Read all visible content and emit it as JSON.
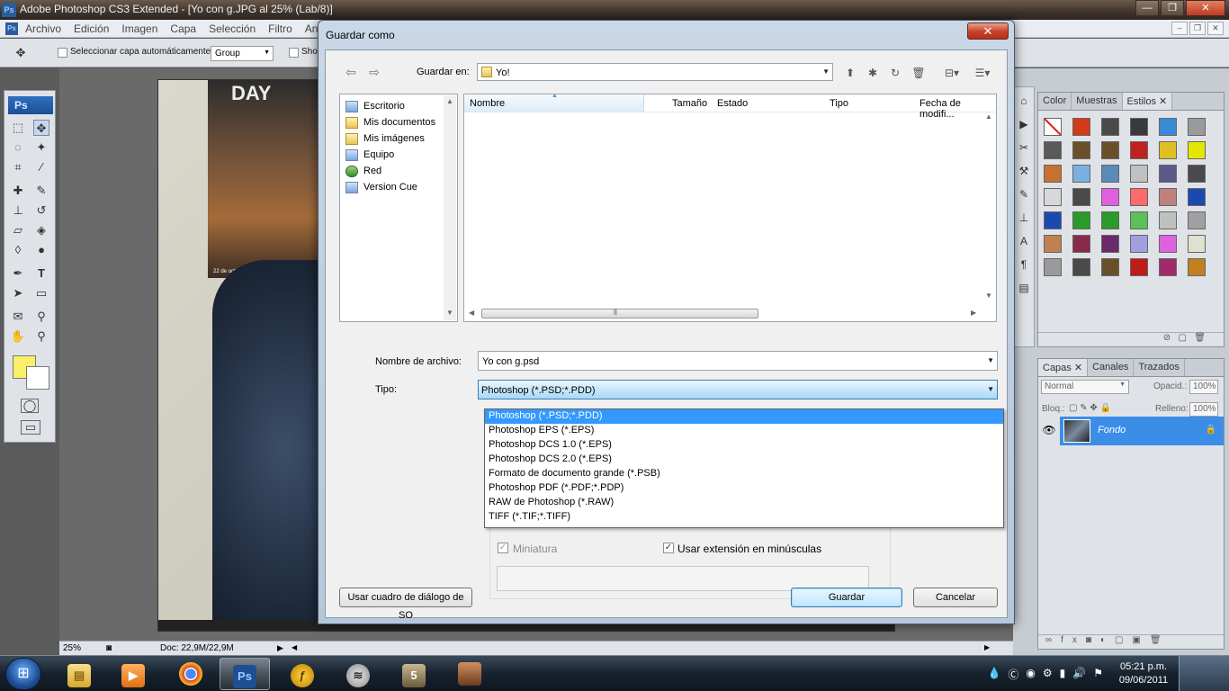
{
  "ps_title": "Adobe Photoshop CS3 Extended - [Yo con g.JPG al 25% (Lab/8)]",
  "window_buttons": {
    "minimize": "—",
    "maximize": "❐",
    "close": "✕"
  },
  "menu": [
    "Archivo",
    "Edición",
    "Imagen",
    "Capa",
    "Selección",
    "Filtro",
    "An"
  ],
  "options_bar": {
    "auto_select_label": "Seleccionar capa automáticamente",
    "group_value": "Group",
    "show_label": "Sho"
  },
  "photo": {
    "poster_text": "DAY",
    "poster_date": "22 de octubre 2010"
  },
  "status": {
    "zoom": "25%",
    "doc": "Doc: 22,9M/22,9M"
  },
  "right_panels": {
    "styles_tabs": [
      "Color",
      "Muestras",
      "Estilos"
    ],
    "styles_swatches": [
      "#ffffff",
      "#d23a1a",
      "#4a4a4a",
      "#3a3a3a",
      "#3a8ad8",
      "#9a9a9a",
      "#5a5a5a",
      "#6b4f2a",
      "#6b4f2a",
      "#c02020",
      "#e0c020",
      "#e6e600",
      "#c87030",
      "#7ab0e0",
      "#5a8ab8",
      "#c0c0c0",
      "#5a5a8a",
      "#4a4a4a",
      "#d8d8d8",
      "#4a4a4a",
      "#e060e0",
      "#ff6a6a",
      "#c08080",
      "#1a4ab0",
      "#1a4ab0",
      "#2a9a2a",
      "#2a9a2a",
      "#5ac05a",
      "#c0c0c0",
      "#a0a0a0",
      "#c08050",
      "#8a2a4a",
      "#6a2a6a",
      "#a0a0e0",
      "#e060e0",
      "#e0e0d0",
      "#9a9a9a",
      "#4a4a4a",
      "#6b4f2a",
      "#c01a1a",
      "#a02a6a",
      "#c08020"
    ],
    "layers_tabs": [
      "Capas",
      "Canales",
      "Trazados"
    ],
    "blend_mode": "Normal",
    "opacity_label": "Opacid.:",
    "opacity_value": "100%",
    "lock_label": "Bloq.:",
    "fill_label": "Relleno:",
    "fill_value": "100%",
    "layer_name": "Fondo"
  },
  "dialog": {
    "title": "Guardar como",
    "save_in_label": "Guardar en:",
    "save_in_value": "Yo!",
    "places": [
      "Escritorio",
      "Mis documentos",
      "Mis imágenes",
      "Equipo",
      "Red",
      "Version Cue"
    ],
    "columns": [
      "Nombre",
      "Tamaño",
      "Estado",
      "Tipo",
      "Fecha de modifi..."
    ],
    "filename_label": "Nombre de archivo:",
    "filename_value": "Yo con g.psd",
    "type_label": "Tipo:",
    "type_value": "Photoshop (*.PSD;*.PDD)",
    "type_options": [
      "Photoshop (*.PSD;*.PDD)",
      "Photoshop EPS (*.EPS)",
      "Photoshop DCS 1.0 (*.EPS)",
      "Photoshop DCS 2.0 (*.EPS)",
      "Formato de documento grande (*.PSB)",
      "Photoshop PDF (*.PDF;*.PDP)",
      "RAW de Photoshop (*.RAW)",
      "TIFF (*.TIF;*.TIFF)"
    ],
    "thumbnail_label": "Miniatura",
    "lowercase_ext_label": "Usar extensión en minúsculas",
    "os_dialog_button": "Usar cuadro de diálogo de SO",
    "save_button": "Guardar",
    "cancel_button": "Cancelar"
  },
  "taskbar": {
    "start_icon": "windows-logo",
    "apps": [
      "explorer",
      "media-player",
      "chrome",
      "photoshop",
      "flash",
      "app",
      "app",
      "app"
    ],
    "time": "05:21 p.m.",
    "date": "09/06/2011"
  }
}
